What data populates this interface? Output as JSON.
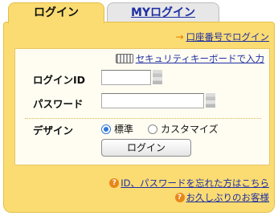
{
  "tabs": {
    "login": "ログイン",
    "my_login": "MYログイン"
  },
  "links": {
    "account_login": "口座番号でログイン",
    "security_keyboard": "セキュリティキーボードで入力",
    "forgot": "ID、パスワードを忘れた方はこちら",
    "long_time": "お久しぶりのお客様"
  },
  "form": {
    "login_id_label": "ログインID",
    "password_label": "パスワード",
    "design_label": "デザイン",
    "radio_standard": "標準",
    "radio_standard_selected": true,
    "radio_custom": "カスタマイズ",
    "radio_custom_selected": false,
    "login_button": "ログイン"
  },
  "icons": {
    "arrow": "right-arrow-icon",
    "keyboard": "keyboard-icon",
    "help": "question-icon"
  },
  "colors": {
    "panel": "#fbdc72",
    "link": "#1f2fa3",
    "accent": "#e9861a"
  }
}
